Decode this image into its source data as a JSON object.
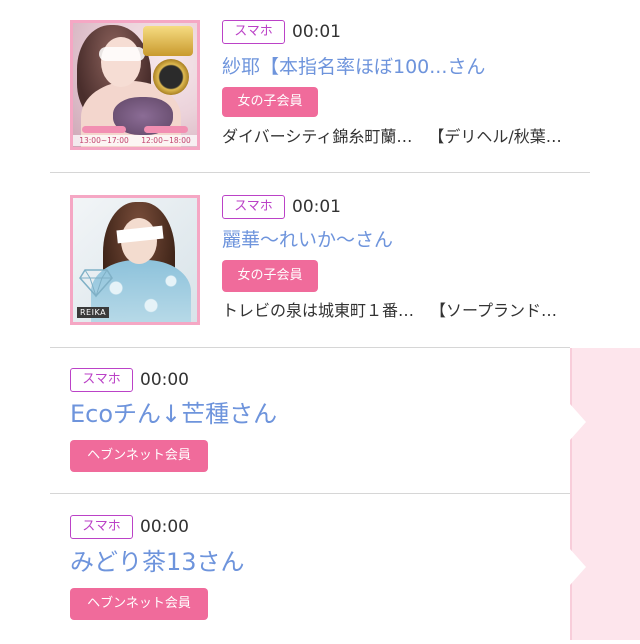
{
  "colors": {
    "badge": "#bb42c7",
    "name_link": "#6e94dc",
    "member_button": "#f06b9b",
    "thumbnail_border": "#f5a7c4",
    "side_ribbon": "#fde5ec",
    "side_ribbon_edge": "#f8cdda",
    "divider": "#d6d6d6",
    "text": "#333333"
  },
  "entries": [
    {
      "device": "スマホ",
      "time": "00:01",
      "name": "紗耶【本指名率ほぼ100...さん",
      "member_type": "女の子会員",
      "shop_area": "ダイバーシティ錦糸町蘭…",
      "shop_genre": "【デリヘル/秋葉…",
      "thumbnail": {
        "schedule": [
          "13:00~17:00",
          "12:00~18:00"
        ]
      }
    },
    {
      "device": "スマホ",
      "time": "00:01",
      "name": "麗華〜れいか〜さん",
      "member_type": "女の子会員",
      "shop_area": "トレビの泉は城東町１番…",
      "shop_genre": "【ソープランド…",
      "thumbnail": {
        "caption": "REIKA"
      }
    },
    {
      "device": "スマホ",
      "time": "00:00",
      "name": "Ecoチん↓芒種さん",
      "member_type": "ヘブンネット会員"
    },
    {
      "device": "スマホ",
      "time": "00:00",
      "name": "みどり茶13さん",
      "member_type": "ヘブンネット会員"
    }
  ]
}
